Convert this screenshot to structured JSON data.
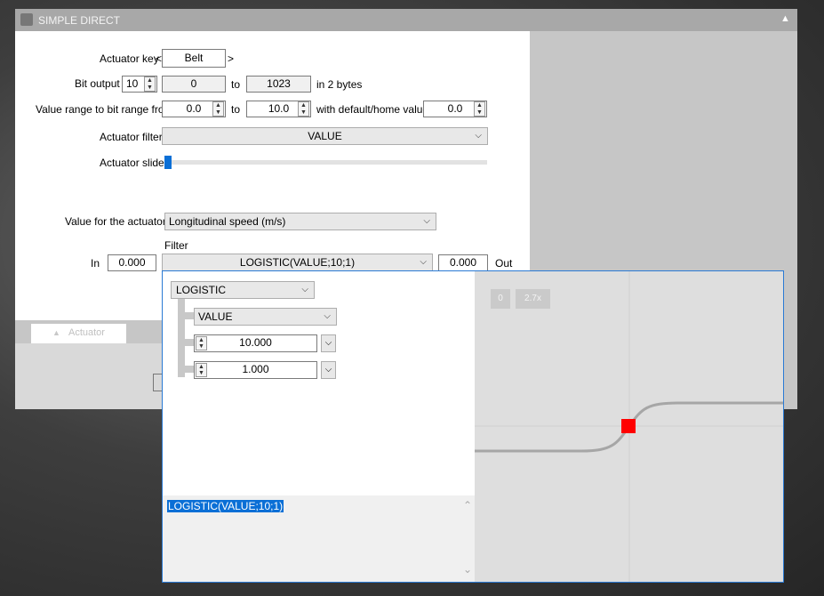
{
  "window": {
    "title": "SIMPLE DIRECT",
    "collapse_glyph": "▲"
  },
  "form": {
    "actuator_key": {
      "label": "Actuator key",
      "prefix": "<",
      "value": "Belt",
      "suffix": ">"
    },
    "bit_output": {
      "label": "Bit output",
      "bits": "10",
      "from": "0",
      "to_label": "to",
      "to": "1023",
      "suffix": "in 2 bytes"
    },
    "value_range": {
      "label": "Value range to bit range from",
      "from": "0.0",
      "to_label": "to",
      "to": "10.0",
      "default_label": "with default/home value",
      "default": "0.0"
    },
    "actuator_filter": {
      "label": "Actuator filter",
      "value": "VALUE"
    },
    "actuator_slider": {
      "label": "Actuator slider",
      "level": 0
    },
    "value_for_actuator": {
      "label": "Value for the actuator",
      "value": "Longitudinal speed (m/s)"
    },
    "filter": {
      "label": "Filter",
      "in_label": "In",
      "in_value": "0.000",
      "expression": "LOGISTIC(VALUE;10;1)",
      "out_value": "0.000",
      "out_label": "Out"
    }
  },
  "tabs": [
    {
      "label": "Actuator",
      "glyph": "▲"
    }
  ],
  "popup": {
    "function": "LOGISTIC",
    "arg1": "VALUE",
    "arg2": "10.000",
    "arg3": "1.000",
    "expression": "LOGISTIC(VALUE;10;1)",
    "graph_buttons": [
      "0",
      "2.7x"
    ],
    "marker_color": "#ff0000",
    "accent_color": "#0a6fd6"
  },
  "icons": {
    "chevron_down": "⌵",
    "spin_up": "▲",
    "spin_down": "▼",
    "scroll_up": "⌃",
    "scroll_down": "⌄"
  }
}
